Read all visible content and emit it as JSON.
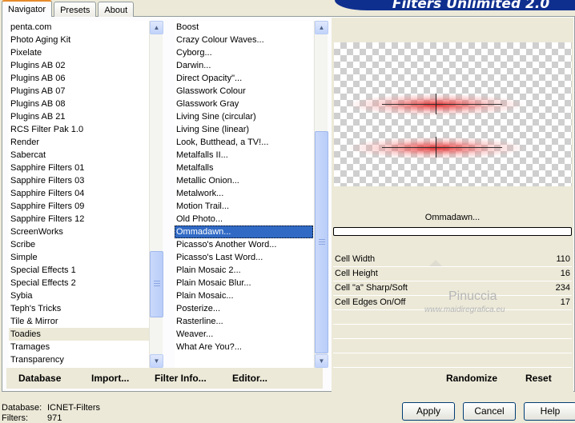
{
  "tabs": [
    "Navigator",
    "Presets",
    "About"
  ],
  "banner": "Filters Unlimited 2.0",
  "categories": {
    "items": [
      "penta.com",
      "Photo Aging Kit",
      "Pixelate",
      "Plugins AB 02",
      "Plugins AB 06",
      "Plugins AB 07",
      "Plugins AB 08",
      "Plugins AB 21",
      "RCS Filter Pak 1.0",
      "Render",
      "Sabercat",
      "Sapphire Filters 01",
      "Sapphire Filters 03",
      "Sapphire Filters 04",
      "Sapphire Filters 09",
      "Sapphire Filters 12",
      "ScreenWorks",
      "Scribe",
      "Simple",
      "Special Effects 1",
      "Special Effects 2",
      "Sybia",
      "Teph's Tricks",
      "Tile & Mirror",
      "Toadies",
      "Tramages",
      "Transparency"
    ],
    "selected": "Toadies"
  },
  "filters": {
    "items": [
      "Boost",
      "Crazy Colour Waves...",
      "Cyborg...",
      "Darwin...",
      "Direct Opacity\"...",
      "Glasswork Colour",
      "Glasswork Gray",
      "Living Sine (circular)",
      "Living Sine (linear)",
      "Look, Butthead, a TV!...",
      "Metalfalls II...",
      "Metalfalls",
      "Metallic Onion...",
      "Metalwork...",
      "Motion Trail...",
      "Old Photo...",
      "Ommadawn...",
      "Picasso's Another Word...",
      "Picasso's Last Word...",
      "Plain Mosaic 2...",
      "Plain Mosaic Blur...",
      "Plain Mosaic...",
      "Posterize...",
      "Rasterline...",
      "Weaver...",
      "What Are You?..."
    ],
    "selected": "Ommadawn..."
  },
  "preview": {
    "filter_name": "Ommadawn...",
    "glow_color": "#e02828"
  },
  "params": [
    {
      "label": "Cell Width",
      "value": "110"
    },
    {
      "label": "Cell Height",
      "value": "16"
    },
    {
      "label": "Cell \"a\" Sharp/Soft",
      "value": "234"
    },
    {
      "label": "Cell Edges On/Off",
      "value": "17"
    }
  ],
  "watermark": {
    "name": "Pinuccia",
    "url": "www.maidiregrafica.eu"
  },
  "toolbar": {
    "database": "Database",
    "import": "Import...",
    "filter_info": "Filter Info...",
    "editor": "Editor...",
    "randomize": "Randomize",
    "reset": "Reset"
  },
  "status": {
    "database_label": "Database:",
    "database_value": "ICNET-Filters",
    "filters_label": "Filters:",
    "filters_value": "971"
  },
  "buttons": {
    "apply": "Apply",
    "cancel": "Cancel",
    "help": "Help"
  }
}
